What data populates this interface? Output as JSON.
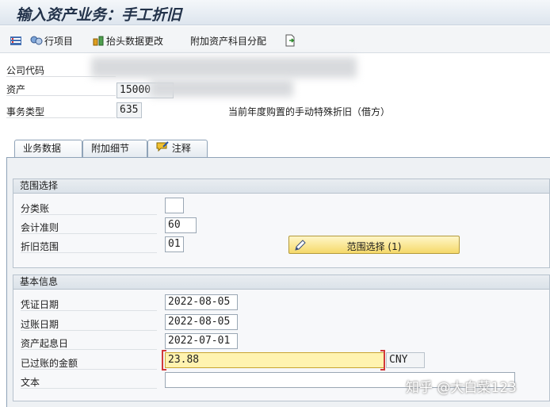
{
  "window": {
    "title": "输入资产业务：手工折旧"
  },
  "toolbar": {
    "items": [
      {
        "label": "行项目",
        "icon": "line-items-icon"
      },
      {
        "label": "抬头数据更改",
        "icon": "header-data-icon"
      },
      {
        "label": "附加资产科目分配",
        "icon": ""
      },
      {
        "label": "",
        "icon": "export-icon"
      }
    ]
  },
  "header": {
    "company_code_label": "公司代码",
    "asset_label": "资产",
    "asset_value": "15000",
    "transaction_type_label": "事务类型",
    "transaction_type_value": "635",
    "transaction_type_desc": "当前年度购置的手动特殊折旧（借方）"
  },
  "tabs": [
    {
      "label": "业务数据",
      "active": true
    },
    {
      "label": "附加细节",
      "active": false
    },
    {
      "label": "注释",
      "active": false,
      "icon": "note-icon"
    }
  ],
  "range_group": {
    "title": "范围选择",
    "ledger_group_label": "分类账",
    "ledger_group_value": "",
    "accounting_principle_label": "会计准则",
    "accounting_principle_value": "60",
    "depreciation_area_label": "折旧范围",
    "depreciation_area_value": "01",
    "range_button_label": "范围选择 (1)"
  },
  "basic_group": {
    "title": "基本信息",
    "document_date_label": "凭证日期",
    "document_date_value": "2022-08-05",
    "posting_date_label": "过账日期",
    "posting_date_value": "2022-08-05",
    "asset_value_date_label": "资产起息日",
    "asset_value_date_value": "2022-07-01",
    "amount_label": "已过账的金额",
    "amount_value": "23.88",
    "currency_value": "CNY",
    "text_label": "文本",
    "text_value": ""
  },
  "watermark": "知乎 @大白菜123",
  "colors": {
    "title": "#22324a",
    "range_button": "#f5d96a",
    "amount_field": "#fff3b0"
  }
}
